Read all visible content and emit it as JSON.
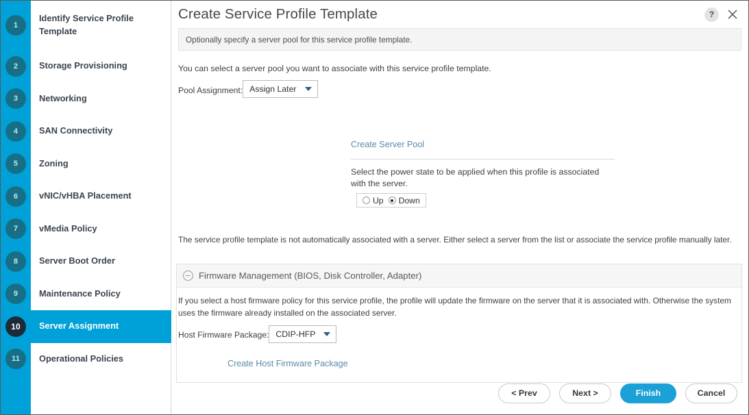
{
  "window": {
    "title": "Create Service Profile Template",
    "help_icon": "question-mark-icon",
    "close_icon": "close-icon",
    "subtitle": "Optionally specify a server pool for this service profile template."
  },
  "sidebar": {
    "items": [
      {
        "number": "1",
        "label": "Identify Service Profile Template",
        "active": false
      },
      {
        "number": "2",
        "label": "Storage Provisioning",
        "active": false
      },
      {
        "number": "3",
        "label": "Networking",
        "active": false
      },
      {
        "number": "4",
        "label": "SAN Connectivity",
        "active": false
      },
      {
        "number": "5",
        "label": "Zoning",
        "active": false
      },
      {
        "number": "6",
        "label": "vNIC/vHBA Placement",
        "active": false
      },
      {
        "number": "7",
        "label": "vMedia Policy",
        "active": false
      },
      {
        "number": "8",
        "label": "Server Boot Order",
        "active": false
      },
      {
        "number": "9",
        "label": "Maintenance Policy",
        "active": false
      },
      {
        "number": "10",
        "label": "Server Assignment",
        "active": true
      },
      {
        "number": "11",
        "label": "Operational Policies",
        "active": false
      }
    ]
  },
  "main": {
    "intro_text": "You can select a server pool you want to associate with this service profile template.",
    "pool_assignment": {
      "label": "Pool Assignment:",
      "value": "Assign Later",
      "caret_icon": "chevron-down-icon"
    },
    "create_server_pool_link": "Create Server Pool",
    "power_state": {
      "description": "Select the power state to be applied when this profile is associated with the server.",
      "options": [
        {
          "label": "Up",
          "selected": false
        },
        {
          "label": "Down",
          "selected": true
        }
      ]
    },
    "note_text": "The service profile template is not automatically associated with a server. Either select a server from the list or associate the service profile manually later."
  },
  "firmware": {
    "header_title": "Firmware Management (BIOS, Disk Controller, Adapter)",
    "collapse_icon": "circle-minus-icon",
    "body_text": "If you select a host firmware policy for this service profile, the profile will update the firmware on the server that it is associated with. Otherwise the system uses the firmware already installed on the associated server.",
    "host_firmware_package": {
      "label": "Host Firmware Package:",
      "value": "CDIP-HFP",
      "caret_icon": "chevron-down-icon"
    },
    "create_link": "Create Host Firmware Package"
  },
  "footer": {
    "prev_label": "< Prev",
    "next_label": "Next >",
    "finish_label": "Finish",
    "cancel_label": "Cancel"
  },
  "colors": {
    "accent_blue": "#00a0d8",
    "badge_teal": "#176f86",
    "active_badge": "#1b2b38",
    "link_blue": "#5b8aa8",
    "primary_button": "#1ba0d7"
  }
}
